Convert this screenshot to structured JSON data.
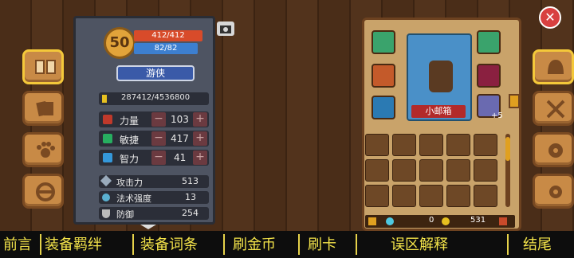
{
  "character": {
    "level": "50",
    "hp": "412/412",
    "mp": "82/82",
    "class_name": "游侠",
    "exp": "287412/4536800"
  },
  "stats": [
    {
      "label": "力量",
      "value": "103",
      "color": "#c0392b"
    },
    {
      "label": "敏捷",
      "value": "417",
      "color": "#27ae60"
    },
    {
      "label": "智力",
      "value": "41",
      "color": "#3498db"
    }
  ],
  "derived": [
    {
      "label": "攻击力",
      "value": "513"
    },
    {
      "label": "法术强度",
      "value": "13"
    },
    {
      "label": "防御",
      "value": "254"
    }
  ],
  "pet": {
    "name": "小邮箱",
    "bonus": "+5"
  },
  "currency": {
    "gems": "0",
    "gold": "531"
  },
  "bottom_nav": [
    "前言",
    "装备羁绊",
    "装备词条",
    "刷金币",
    "刷卡",
    "误区解释",
    "结尾"
  ],
  "icons": {
    "close": "close-icon",
    "camera": "camera-icon",
    "book": "book-icon",
    "pet": "paw-icon",
    "steering": "wheel-icon"
  }
}
